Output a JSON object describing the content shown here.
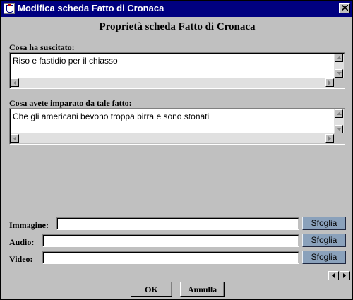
{
  "window": {
    "title": "Modifica scheda Fatto di Cronaca"
  },
  "panel": {
    "title": "Proprietà scheda Fatto di Cronaca"
  },
  "reaction": {
    "label": "Cosa ha suscitato:",
    "value": "Riso e fastidio per il chiasso"
  },
  "learned": {
    "label": "Cosa avete imparato da tale fatto:",
    "value": "Che gli americani bevono troppa birra e sono stonati"
  },
  "media": [
    {
      "label": "Immagine:",
      "value": "",
      "button": "Sfoglia"
    },
    {
      "label": "Audio:",
      "value": "",
      "button": "Sfoglia"
    },
    {
      "label": "Video:",
      "value": "",
      "button": "Sfoglia"
    }
  ],
  "footer": {
    "ok": "OK",
    "cancel": "Annulla"
  },
  "icons": {
    "close": "close-icon",
    "window": "java-cup-icon",
    "prev": "arrow-left-icon",
    "next": "arrow-right-icon"
  },
  "colors": {
    "titlebar": "#000080",
    "background": "#c0c0c0",
    "browse_button": "#8aa1bb"
  }
}
